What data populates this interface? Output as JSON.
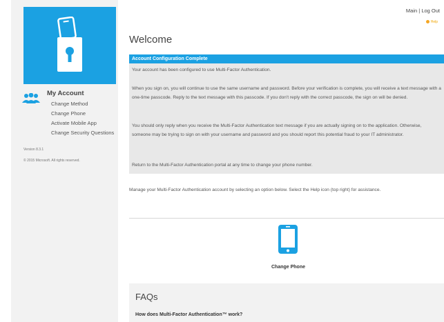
{
  "colors": {
    "accent": "#1ba1e2",
    "help": "#f5a623",
    "panel": "#e8e8e8",
    "sidebar": "#f2f2f2"
  },
  "header": {
    "main_link": "Main",
    "separator": " | ",
    "logout_link": "Log Out",
    "help_label": "Help"
  },
  "sidebar": {
    "logo_icon": "phone-lock-icon",
    "account_icon": "people-icon",
    "title": "My Account",
    "items": [
      {
        "label": "Change Method"
      },
      {
        "label": "Change Phone"
      },
      {
        "label": "Activate Mobile App"
      },
      {
        "label": "Change Security Questions"
      }
    ],
    "version": "Version 8.3.1",
    "copyright": "© 2015 Microsoft. All rights reserved."
  },
  "main": {
    "title": "Welcome",
    "config": {
      "header": "Account Configuration Complete",
      "paragraphs": [
        "Your account has been configured to use Multi-Factor Authentication.",
        "When you sign on, you will continue to use the same username and password. Before your verification is complete, you will receive a text message with a one-time passcode. Reply to the text message with this passcode. If you don't reply with the correct passcode, the sign on will be denied.",
        "You should only reply when you receive the Multi-Factor Authentication text message if you are actually signing on to the application. Otherwise, someone may be trying to sign on with your username and password and you should report this potential fraud to your IT administrator.",
        "Return to the Multi-Factor Authentication portal at any time to change your phone number."
      ]
    },
    "manage_text": "Manage your Multi-Factor Authentication account by selecting an option below. Select the Help icon (top right) for assistance.",
    "options": [
      {
        "label": "Change Phone",
        "icon": "mobile-phone-icon"
      }
    ],
    "faq": {
      "title": "FAQs",
      "questions": [
        "How does Multi-Factor Authentication™ work?"
      ]
    }
  }
}
